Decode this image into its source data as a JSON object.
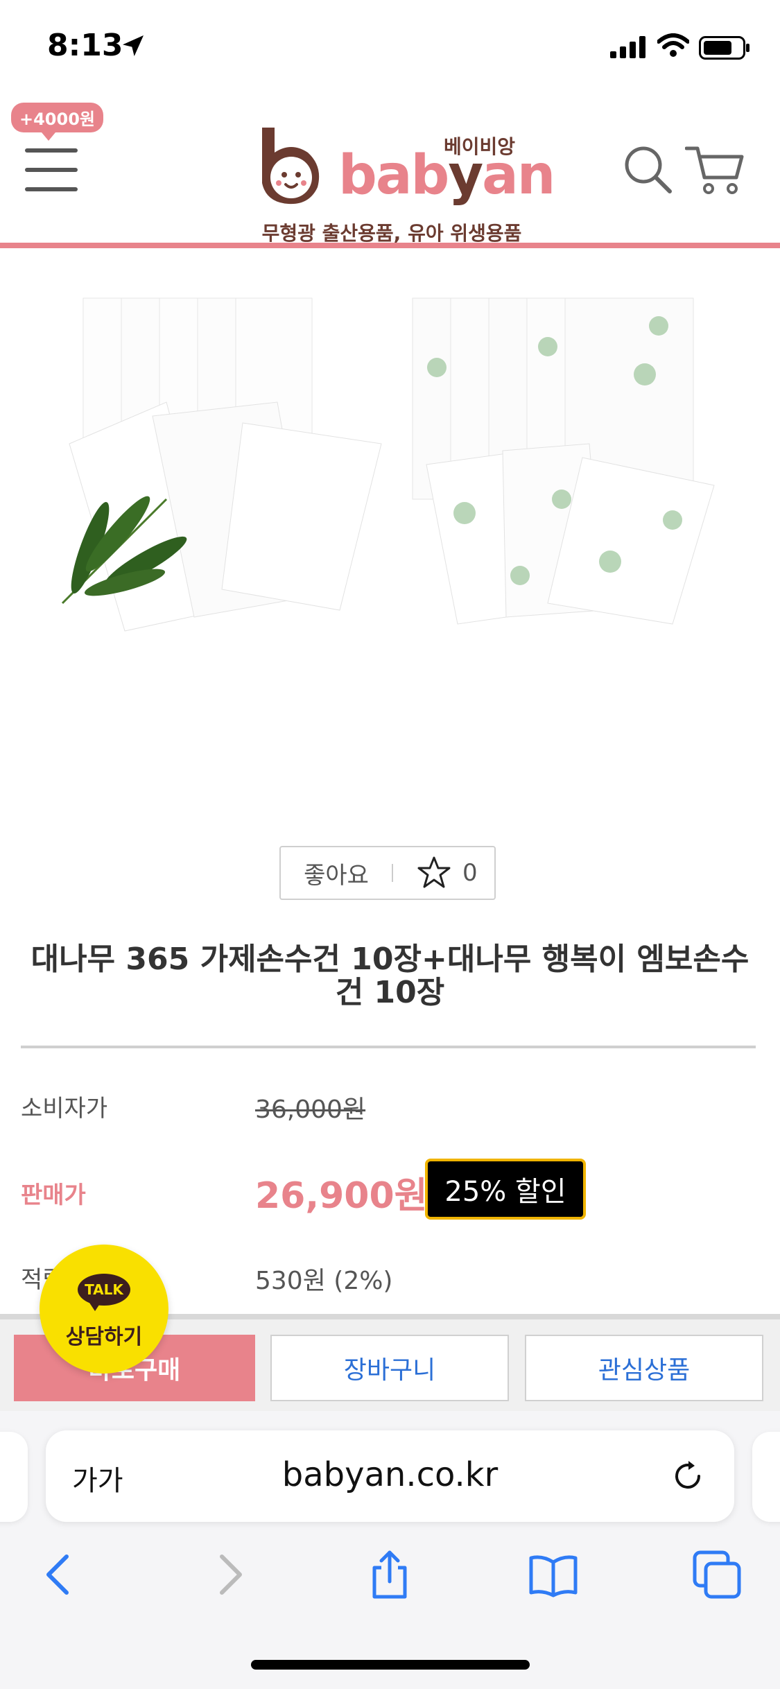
{
  "status_bar": {
    "time": "8:13"
  },
  "header": {
    "promo_badge": "+4000원",
    "logo_korean": "베이비앙",
    "logo_word_pink1": "bab",
    "logo_word_brown": "y",
    "logo_word_pink2": "an",
    "tagline": "무형광 출산용품, 유아 위생용품"
  },
  "like": {
    "label": "좋아요",
    "count": "0"
  },
  "product": {
    "title": "대나무 365 가제손수건 10장+대나무 행복이 엠보손수건 10장",
    "consumer_price_label": "소비자가",
    "consumer_price": "36,000원",
    "sale_price_label": "판매가",
    "sale_price": "26,900원",
    "discount_badge": "25% 할인",
    "points_label": "적립금",
    "points_value": "530원 (2%)"
  },
  "actions": {
    "buy_label": "바로구매",
    "cart_label": "장바구니",
    "wish_label": "관심상품"
  },
  "kakao": {
    "bubble": "TALK",
    "label": "상담하기"
  },
  "browser": {
    "aa_label": "가가",
    "url": "babyan.co.kr"
  },
  "colors": {
    "brand_pink": "#e8838b",
    "brand_brown": "#6b3b30",
    "link_blue": "#2b6fd6",
    "kakao_yellow": "#f9e000"
  }
}
